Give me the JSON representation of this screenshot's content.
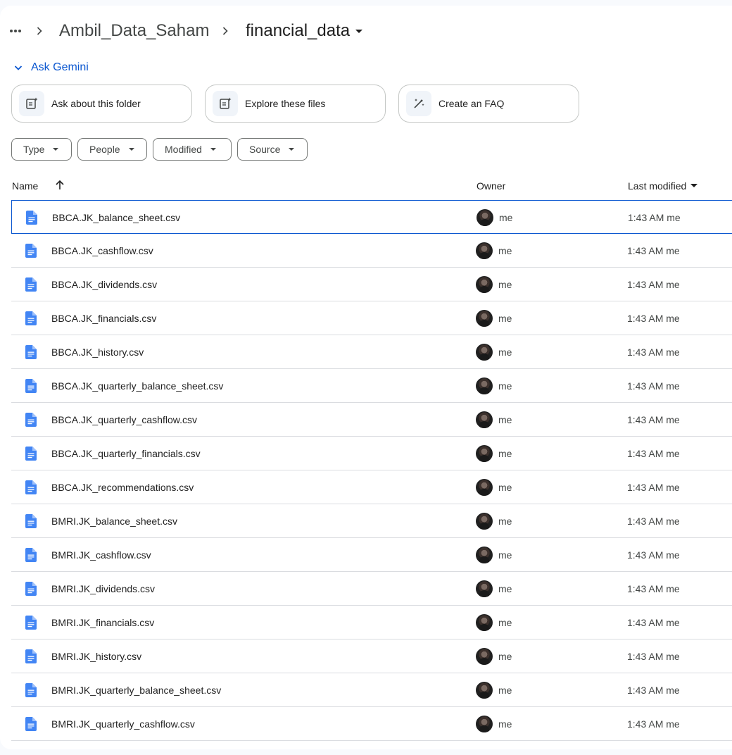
{
  "breadcrumb": {
    "parent": "Ambil_Data_Saham",
    "current": "financial_data"
  },
  "gemini": {
    "toggle_label": "Ask Gemini",
    "chips": [
      {
        "label": "Ask about this folder",
        "icon": "folder-sparkle-icon"
      },
      {
        "label": "Explore these files",
        "icon": "files-sparkle-icon"
      },
      {
        "label": "Create an FAQ",
        "icon": "magic-pen-icon"
      }
    ]
  },
  "filters": [
    "Type",
    "People",
    "Modified",
    "Source"
  ],
  "table": {
    "headers": {
      "name": "Name",
      "owner": "Owner",
      "last_modified": "Last modified"
    },
    "rows": [
      {
        "name": "BBCA.JK_balance_sheet.csv",
        "owner": "me",
        "modified": "1:43 AM me"
      },
      {
        "name": "BBCA.JK_cashflow.csv",
        "owner": "me",
        "modified": "1:43 AM me"
      },
      {
        "name": "BBCA.JK_dividends.csv",
        "owner": "me",
        "modified": "1:43 AM me"
      },
      {
        "name": "BBCA.JK_financials.csv",
        "owner": "me",
        "modified": "1:43 AM me"
      },
      {
        "name": "BBCA.JK_history.csv",
        "owner": "me",
        "modified": "1:43 AM me"
      },
      {
        "name": "BBCA.JK_quarterly_balance_sheet.csv",
        "owner": "me",
        "modified": "1:43 AM me"
      },
      {
        "name": "BBCA.JK_quarterly_cashflow.csv",
        "owner": "me",
        "modified": "1:43 AM me"
      },
      {
        "name": "BBCA.JK_quarterly_financials.csv",
        "owner": "me",
        "modified": "1:43 AM me"
      },
      {
        "name": "BBCA.JK_recommendations.csv",
        "owner": "me",
        "modified": "1:43 AM me"
      },
      {
        "name": "BMRI.JK_balance_sheet.csv",
        "owner": "me",
        "modified": "1:43 AM me"
      },
      {
        "name": "BMRI.JK_cashflow.csv",
        "owner": "me",
        "modified": "1:43 AM me"
      },
      {
        "name": "BMRI.JK_dividends.csv",
        "owner": "me",
        "modified": "1:43 AM me"
      },
      {
        "name": "BMRI.JK_financials.csv",
        "owner": "me",
        "modified": "1:43 AM me"
      },
      {
        "name": "BMRI.JK_history.csv",
        "owner": "me",
        "modified": "1:43 AM me"
      },
      {
        "name": "BMRI.JK_quarterly_balance_sheet.csv",
        "owner": "me",
        "modified": "1:43 AM me"
      },
      {
        "name": "BMRI.JK_quarterly_cashflow.csv",
        "owner": "me",
        "modified": "1:43 AM me"
      }
    ],
    "selected_index": 0
  },
  "colors": {
    "accent": "#0b57d0",
    "doc_icon": "#4285f4"
  }
}
